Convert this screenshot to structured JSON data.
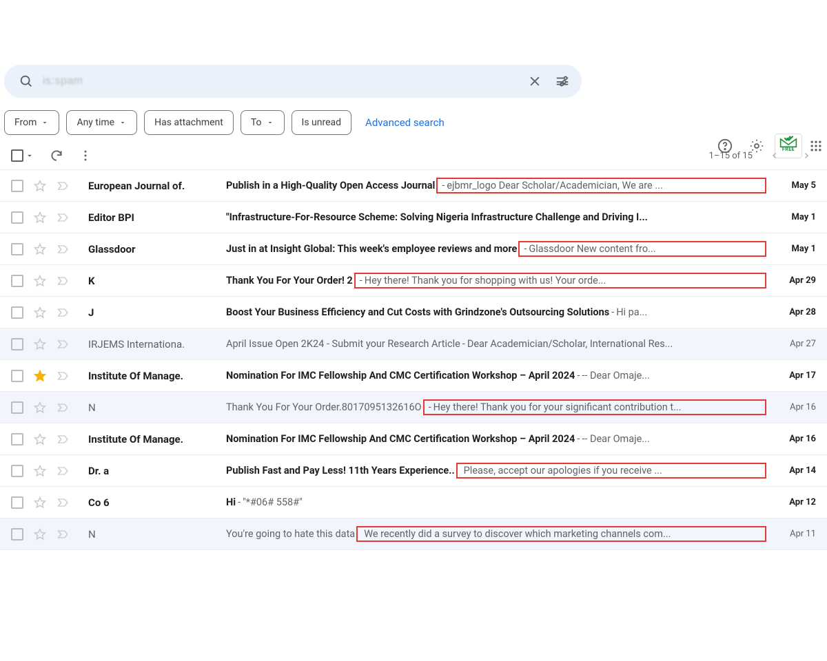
{
  "search": {
    "value": "is:spam",
    "clear_aria": "Clear search",
    "tune_aria": "Show search options"
  },
  "topbar": {
    "help_aria": "Support",
    "settings_aria": "Settings",
    "free_label": "FREE",
    "apps_aria": "Google apps"
  },
  "filters": {
    "from": "From",
    "anytime": "Any time",
    "attachment": "Has attachment",
    "to": "To",
    "unread": "Is unread",
    "advanced": "Advanced search"
  },
  "toolbar": {
    "page_label": "1–15 of 15"
  },
  "emails": [
    {
      "sender": "European Journal of.",
      "subject": "Publish in a High-Quality Open Access Journal",
      "snippet": "ejbmr_logo Dear Scholar/Academician, We are ...",
      "date": "May 5",
      "unread": true,
      "starred": false,
      "highlight": true,
      "sep": " - "
    },
    {
      "sender": "Editor BPI",
      "subject": "\"Infrastructure-For-Resource Scheme: Solving Nigeria Infrastructure Challenge and Driving I...",
      "snippet": "",
      "date": "May 1",
      "unread": true,
      "starred": false,
      "highlight": false,
      "sep": ""
    },
    {
      "sender": "Glassdoor",
      "subject": "Just in at Insight Global: This week's employee reviews and more",
      "snippet": "Glassdoor New content fro...",
      "date": "May 1",
      "unread": true,
      "starred": false,
      "highlight": true,
      "sep": " - "
    },
    {
      "sender": "K",
      "subject": "Thank You For Your Order!                       2",
      "snippet": "Hey there! Thank you for shopping with us! Your orde...",
      "date": "Apr 29",
      "unread": true,
      "starred": false,
      "highlight": true,
      "sep": " - "
    },
    {
      "sender": "J",
      "subject": "Boost Your Business Efficiency and Cut Costs with Grindzone's Outsourcing Solutions",
      "snippet": "Hi pa...",
      "date": "Apr 28",
      "unread": true,
      "starred": false,
      "highlight": false,
      "sep": " - "
    },
    {
      "sender": "IRJEMS Internationa.",
      "subject": "April Issue Open 2K24 - Submit your Research Article",
      "snippet": "Dear Academician/Scholar, International Res...",
      "date": "Apr 27",
      "unread": false,
      "starred": false,
      "highlight": false,
      "sep": " - "
    },
    {
      "sender": "Institute Of Manage.",
      "subject": "Nomination For IMC Fellowship And CMC Certification Workshop – April 2024",
      "snippet": "-- Dear Omaje...",
      "date": "Apr 17",
      "unread": true,
      "starred": true,
      "highlight": false,
      "sep": " - "
    },
    {
      "sender": "N",
      "subject": "Thank You For Your Order.8017095132616O",
      "snippet": "Hey there! Thank you for your significant contribution t...",
      "date": "Apr 16",
      "unread": false,
      "starred": false,
      "highlight": true,
      "sep": " - "
    },
    {
      "sender": "Institute Of Manage.",
      "subject": "Nomination For IMC Fellowship And CMC Certification Workshop – April 2024",
      "snippet": "-- Dear Omaje...",
      "date": "Apr 16",
      "unread": true,
      "starred": false,
      "highlight": false,
      "sep": " - "
    },
    {
      "sender": "Dr.                     a",
      "subject": "Publish Fast and Pay Less! 11th Years Experience..",
      "snippet": "Please, accept our apologies if you receive ...",
      "date": "Apr 14",
      "unread": true,
      "starred": false,
      "highlight": true,
      "sep": "  "
    },
    {
      "sender": "Co                    6",
      "subject": "Hi",
      "snippet": "\"*#06#                   558#\"",
      "date": "Apr 12",
      "unread": true,
      "starred": false,
      "highlight": false,
      "sep": " - "
    },
    {
      "sender": "N",
      "subject": "You're going to hate this data",
      "snippet": "We recently did a survey to discover which marketing channels com...",
      "date": "Apr 11",
      "unread": false,
      "starred": false,
      "highlight": true,
      "sep": "  "
    }
  ]
}
